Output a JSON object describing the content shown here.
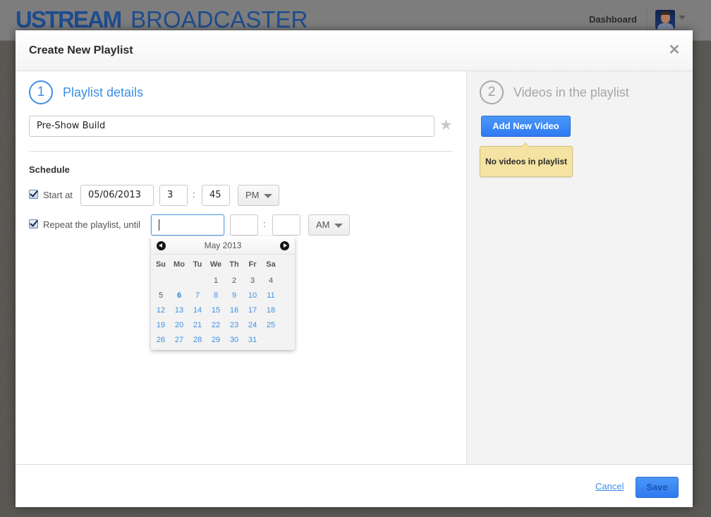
{
  "app": {
    "logo_primary": "USTREAM",
    "logo_secondary": "BROADCASTER",
    "dashboard_link": "Dashboard",
    "avatar_menu_icon": "chevron-down-icon"
  },
  "modal": {
    "title": "Create New Playlist",
    "close_icon": "close-icon",
    "close_glyph": "✕",
    "step1": {
      "number": "1",
      "title": "Playlist details",
      "playlist_name_value": "Pre-Show Build",
      "favorite_icon": "star-icon",
      "favorite_glyph": "★",
      "schedule_label": "Schedule",
      "start": {
        "checked": true,
        "label": "Start at",
        "date": "05/06/2013",
        "hour": "3",
        "minute": "45",
        "separator": ":",
        "ampm": "PM"
      },
      "repeat": {
        "checked": true,
        "label": "Repeat the playlist, until",
        "date": "",
        "hour": "",
        "minute": "",
        "separator": ":",
        "ampm": "AM"
      }
    },
    "datepicker": {
      "month_label": "May 2013",
      "prev_icon": "chevron-left-circle-icon",
      "next_icon": "chevron-right-circle-icon",
      "weekdays": [
        "Su",
        "Mo",
        "Tu",
        "We",
        "Th",
        "Fr",
        "Sa"
      ],
      "leading_blanks": 3,
      "days": [
        "1",
        "2",
        "3",
        "4",
        "5",
        "6",
        "7",
        "8",
        "9",
        "10",
        "11",
        "12",
        "13",
        "14",
        "15",
        "16",
        "17",
        "18",
        "19",
        "20",
        "21",
        "22",
        "23",
        "24",
        "25",
        "26",
        "27",
        "28",
        "29",
        "30",
        "31"
      ],
      "today": "6",
      "disabled_through": "5",
      "accent_color": "#3d8fe5"
    },
    "step2": {
      "number": "2",
      "title": "Videos in the playlist",
      "add_video_label": "Add New Video",
      "empty_message": "No videos in playlist"
    },
    "footer": {
      "cancel_label": "Cancel",
      "save_label": "Save"
    }
  }
}
